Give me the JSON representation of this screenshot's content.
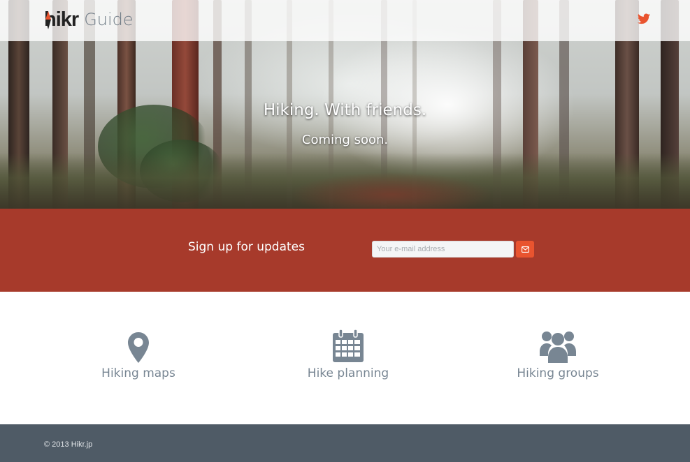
{
  "navbar": {
    "logo_text": "hikr",
    "title": "Guide",
    "social_icon": "twitter-icon",
    "accent_color": "#e9542f"
  },
  "hero": {
    "title": "Hiking. With friends.",
    "subtitle": "Coming soon."
  },
  "signup": {
    "label": "Sign up for updates",
    "email_placeholder": "Your e-mail address",
    "email_value": "",
    "submit_icon": "envelope-icon",
    "background_color": "#a73a2b"
  },
  "features": [
    {
      "label": "Hiking maps",
      "icon": "map-marker-icon"
    },
    {
      "label": "Hike planning",
      "icon": "calendar-icon"
    },
    {
      "label": "Hiking groups",
      "icon": "users-icon"
    }
  ],
  "footer": {
    "copyright": "© 2013 Hikr.jp",
    "background_color": "#4f5b66"
  }
}
